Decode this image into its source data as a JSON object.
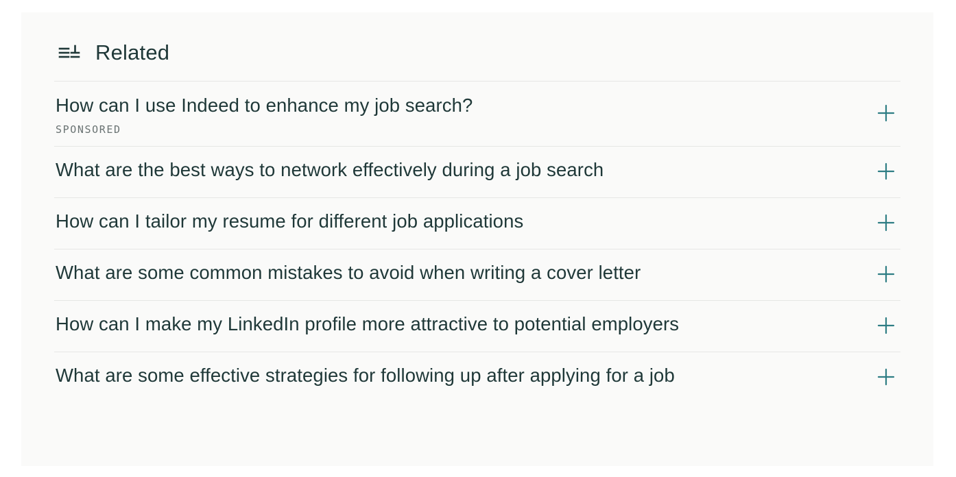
{
  "section": {
    "title": "Related",
    "icon": "related-list-icon"
  },
  "items": [
    {
      "question": "How can I use Indeed to enhance my job search?",
      "tag": "SPONSORED",
      "action_icon": "plus-icon"
    },
    {
      "question": "What are the best ways to network effectively during a job search",
      "action_icon": "plus-icon"
    },
    {
      "question": "How can I tailor my resume for different job applications",
      "action_icon": "plus-icon"
    },
    {
      "question": "What are some common mistakes to avoid when writing a cover letter",
      "action_icon": "plus-icon"
    },
    {
      "question": "How can I make my LinkedIn profile more attractive to potential employers",
      "action_icon": "plus-icon"
    },
    {
      "question": "What are some effective strategies for following up after applying for a job",
      "action_icon": "plus-icon"
    }
  ],
  "colors": {
    "text": "#1f3838",
    "accent": "#2e7d84",
    "muted": "#6a7373",
    "divider": "#e6e7e5",
    "panel": "#fafaf9"
  }
}
